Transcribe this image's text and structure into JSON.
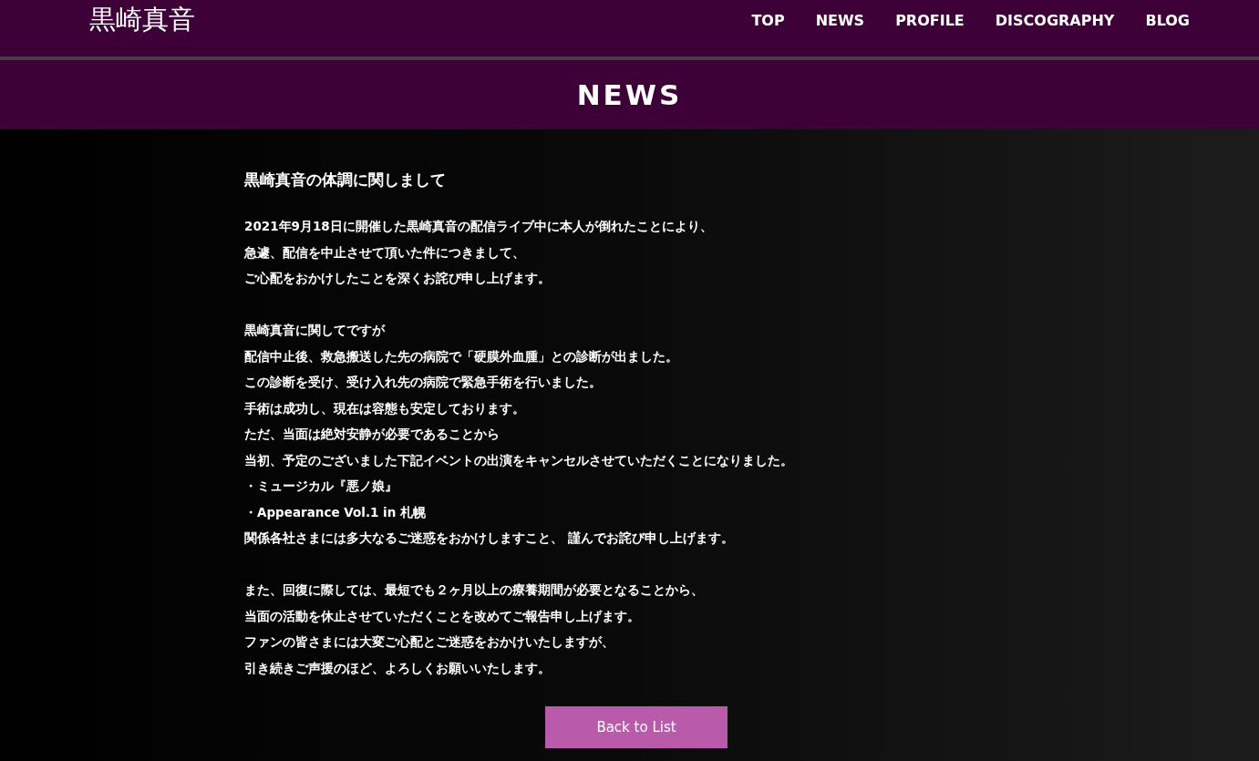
{
  "site_title": "黒崎真音",
  "nav": [
    {
      "label": "TOP"
    },
    {
      "label": "NEWS"
    },
    {
      "label": "PROFILE"
    },
    {
      "label": "DISCOGRAPHY"
    },
    {
      "label": "BLOG"
    }
  ],
  "page_heading": "NEWS",
  "article": {
    "title": "黒崎真音の体調に関しまして",
    "paragraphs": [
      [
        "2021年9月18日に開催した黒崎真音の配信ライブ中に本人が倒れたことにより、",
        "急遽、配信を中止させて頂いた件につきまして、",
        "ご心配をおかけしたことを深くお詫び申し上げます。"
      ],
      [
        "黒崎真音に関してですが",
        "配信中止後、救急搬送した先の病院で「硬膜外血腫」との診断が出ました。",
        "この診断を受け、受け入れ先の病院で緊急手術を行いました。",
        "手術は成功し、現在は容態も安定しております。",
        "ただ、当面は絶対安静が必要であることから",
        "当初、予定のございました下記イベントの出演をキャンセルさせていただくことになりました。",
        "・ミュージカル『悪ノ娘』",
        "・Appearance Vol.1 in 札幌",
        "関係各社さまには多大なるご迷惑をおかけしますこと、 謹んでお詫び申し上げます。"
      ],
      [
        "また、回復に際しては、最短でも２ヶ月以上の療養期間が必要となることから、",
        "当面の活動を休止させていただくことを改めてご報告申し上げます。",
        "ファンの皆さまには大変ご心配とご迷惑をおかけいたしますが、",
        "引き続きご声援のほど、よろしくお願いいたします。"
      ]
    ]
  },
  "back_button": "Back to List"
}
